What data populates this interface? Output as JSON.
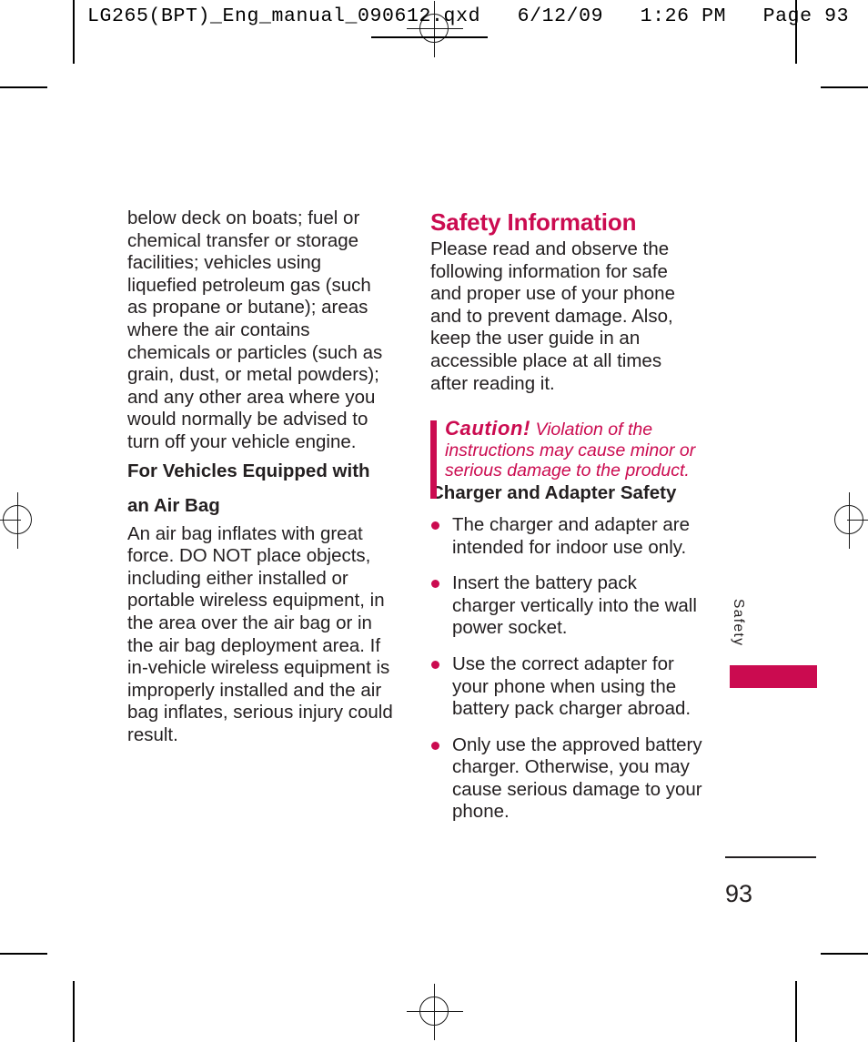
{
  "print_header": {
    "text": "LG265(BPT)_Eng_manual_090612.qxd   6/12/09   1:26 PM   Page 93"
  },
  "colors": {
    "accent": "#CB0B50",
    "body_text": "#231f20"
  },
  "left_column": {
    "paragraphs": [
      "below deck on boats; fuel or chemical transfer or storage facilities; vehicles using liquefied petroleum gas (such as propane or butane); areas where the air contains chemicals or particles (such as grain, dust, or metal powders); and any other area where you would normally be advised to turn off your vehicle engine."
    ],
    "subheading": "For Vehicles Equipped with an Air Bag",
    "paragraphs_after": [
      "An air bag inflates with great force. DO NOT place objects, including either installed or portable wireless equipment, in the area over the air bag or in the air bag deployment area. If in-vehicle wireless equipment is improperly installed and the air bag inflates, serious injury could result."
    ]
  },
  "right_column": {
    "heading": "Safety Information",
    "intro": "Please read and observe the following information for safe and proper use of your phone and to prevent damage. Also, keep the user guide in an accessible place at all times after reading it.",
    "caution": {
      "word": "Caution!",
      "text": "Violation of the instructions may cause minor or serious damage to the product."
    },
    "subheading": "Charger and Adapter Safety",
    "bullets": [
      "The charger and adapter are intended for indoor use only.",
      "Insert the battery pack charger vertically into the wall power socket.",
      "Use the correct adapter for your phone when using the battery pack charger abroad.",
      "Only use the approved battery charger. Otherwise, you may cause serious damage to your phone."
    ]
  },
  "side_tab": {
    "label": "Safety"
  },
  "folio": {
    "page_number": "93"
  }
}
